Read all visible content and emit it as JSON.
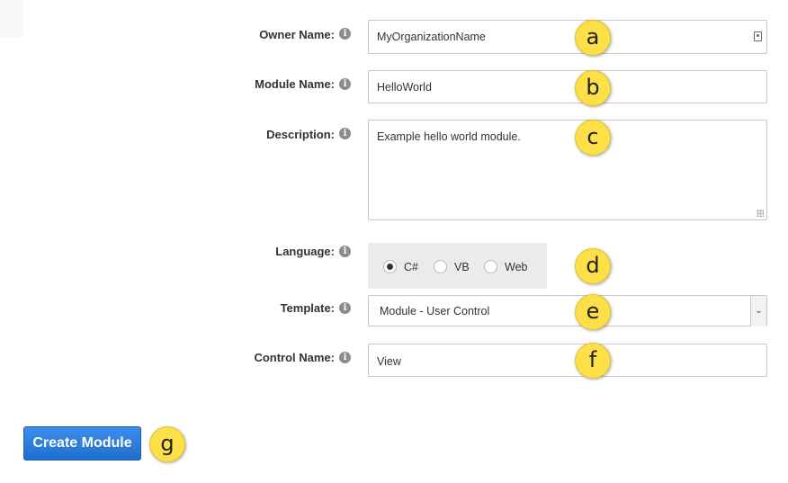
{
  "form": {
    "owner_name": {
      "label": "Owner Name:",
      "value": "MyOrganizationName",
      "callout": "a"
    },
    "module_name": {
      "label": "Module Name:",
      "value": "HelloWorld",
      "callout": "b"
    },
    "description": {
      "label": "Description:",
      "value": "Example hello world module.",
      "callout": "c"
    },
    "language": {
      "label": "Language:",
      "callout": "d",
      "options": [
        {
          "label": "C#",
          "checked": true
        },
        {
          "label": "VB",
          "checked": false
        },
        {
          "label": "Web",
          "checked": false
        }
      ]
    },
    "template": {
      "label": "Template:",
      "selected": "Module - User Control",
      "callout": "e"
    },
    "control_name": {
      "label": "Control Name:",
      "value": "View",
      "callout": "f"
    }
  },
  "actions": {
    "create_label": "Create Module",
    "callout": "g"
  },
  "icons": {
    "info": "info-icon",
    "contact": "contact-card-icon",
    "dropdown": "chevron-down-icon"
  },
  "colors": {
    "callout": "#fde047",
    "button": "#2a7ad8",
    "language_panel": "#ebebeb"
  }
}
